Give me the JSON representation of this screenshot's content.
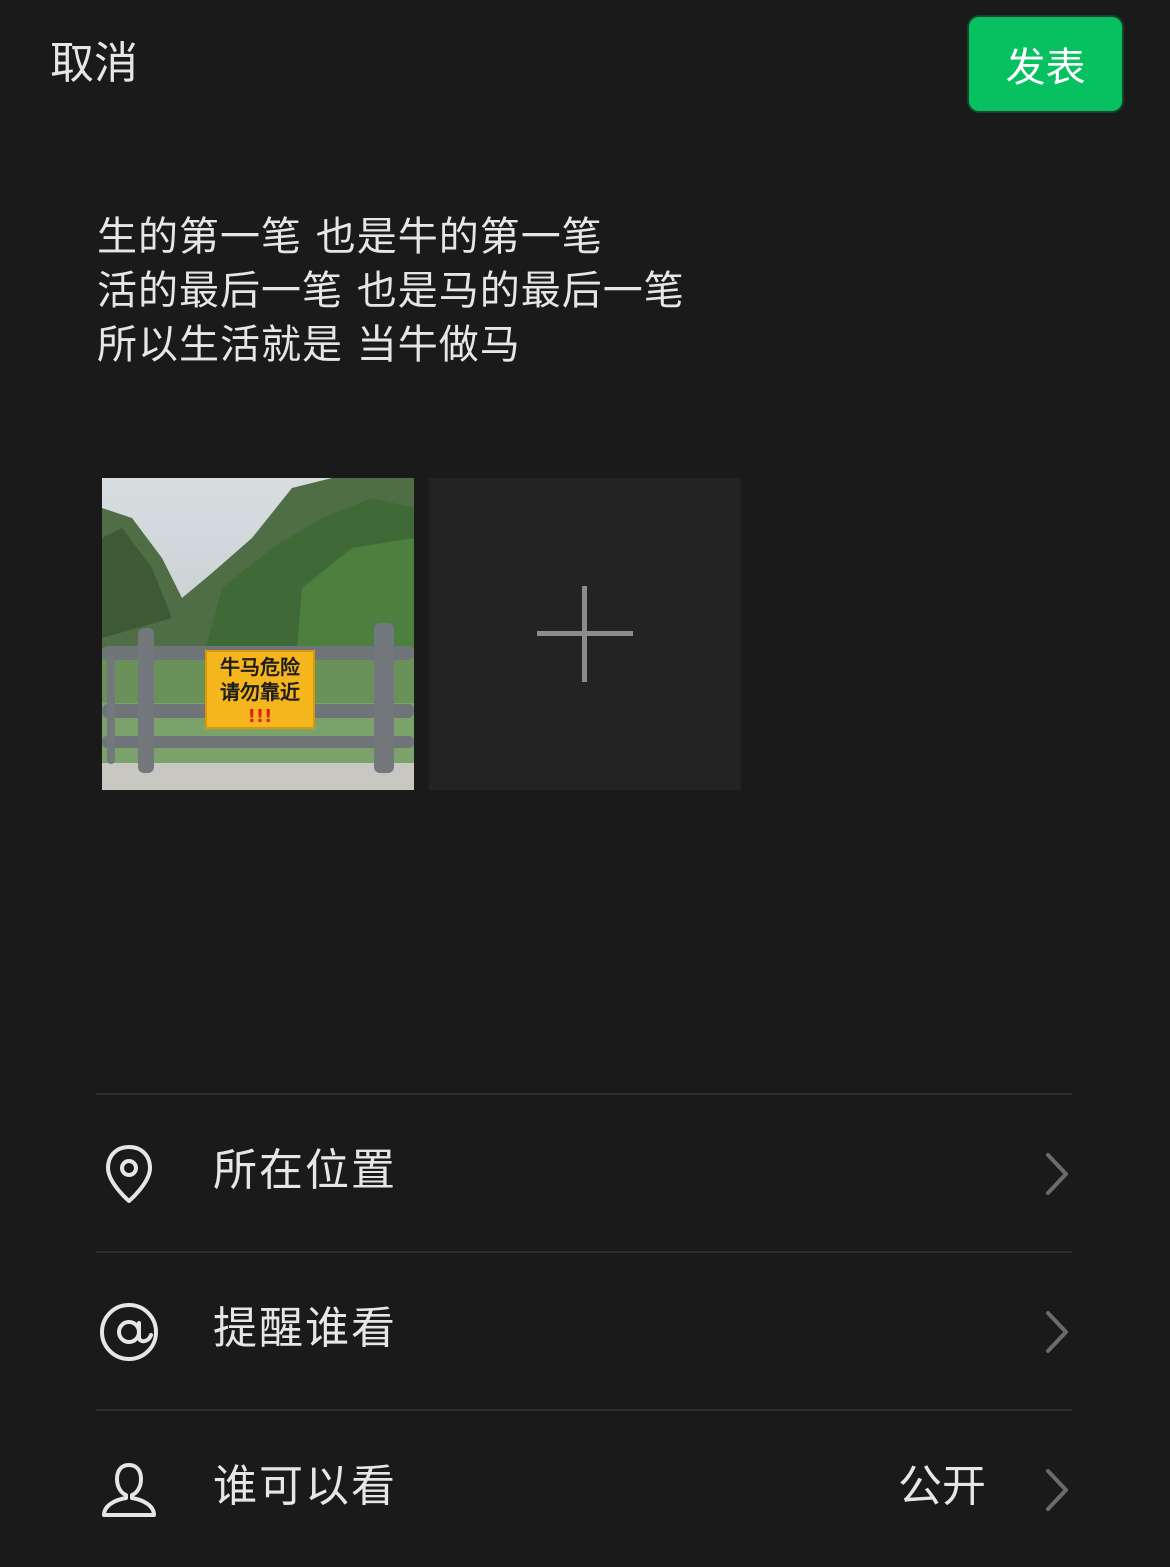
{
  "header": {
    "cancel_label": "取消",
    "publish_label": "发表"
  },
  "post": {
    "text": "生的第一笔 也是牛的第一笔\n活的最后一笔 也是马的最后一笔\n所以生活就是 当牛做马",
    "image_sign_line1": "牛马危险",
    "image_sign_line2": "请勿靠近",
    "image_sign_line3": "!!!"
  },
  "options": [
    {
      "label": "所在位置",
      "icon": "location-pin-icon",
      "value": ""
    },
    {
      "label": "提醒谁看",
      "icon": "at-sign-icon",
      "value": ""
    },
    {
      "label": "谁可以看",
      "icon": "person-icon",
      "value": "公开"
    }
  ],
  "colors": {
    "background": "#1a1a1a",
    "accent": "#07c160",
    "text": "#e6e6e6",
    "divider": "#2c2c2c"
  }
}
